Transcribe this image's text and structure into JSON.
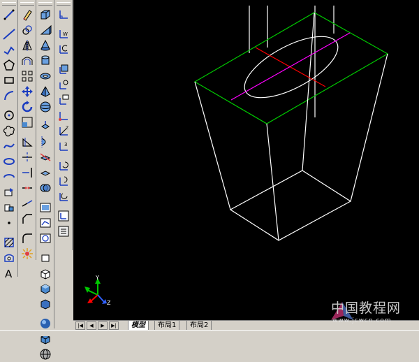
{
  "toolbars": {
    "draw": [
      "line-icon",
      "construction-line-icon",
      "polyline-icon",
      "polygon-icon",
      "rectangle-icon",
      "arc-icon",
      "circle-icon",
      "revision-cloud-icon",
      "spline-icon",
      "ellipse-icon",
      "ellipse-arc-icon",
      "insert-block-icon",
      "make-block-icon",
      "point-icon",
      "hatch-icon",
      "region-icon",
      "multiline-text-icon"
    ],
    "modify": [
      "erase-icon",
      "copy-icon",
      "mirror-icon",
      "offset-icon",
      "array-icon",
      "move-icon",
      "rotate-icon",
      "scale-icon",
      "stretch-icon",
      "trim-icon",
      "extend-icon",
      "break-icon",
      "join-icon",
      "chamfer-icon",
      "fillet-icon",
      "explode-icon"
    ],
    "solids": [
      "box-icon",
      "wedge-icon",
      "cone-icon",
      "cylinder-icon",
      "torus-icon",
      "pyramid-icon",
      "sphere-icon",
      "extrude-icon",
      "revolve-icon",
      "slice-icon",
      "section-icon",
      "interference-icon",
      "setup-view-icon",
      "setup-drawing-icon",
      "setup-profile-icon",
      "shade-2d-icon",
      "shade-3d-icon",
      "shade-gouraud-icon",
      "shade-flat-icon",
      "sphere-shaded-icon",
      "box-shaded-icon",
      "globe-icon"
    ],
    "ucs": [
      "ucs-icon",
      "ucs-world-icon",
      "ucs-previous-icon",
      "ucs-face-icon",
      "ucs-object-icon",
      "ucs-view-icon",
      "ucs-origin-icon",
      "ucs-zaxis-icon",
      "ucs-3point-icon",
      "ucs-x-icon",
      "ucs-y-icon",
      "ucs-z-icon",
      "ucs-apply-icon",
      "ucs-named-icon"
    ]
  },
  "layout_tabs": {
    "model": "模型",
    "layout1": "布局1",
    "layout2": "布局2"
  },
  "nav": {
    "first": "|◀",
    "prev": "◀",
    "next": "▶",
    "last": "▶|"
  },
  "ucs_axes": {
    "y": "Y",
    "z": "Z"
  },
  "watermark": {
    "title": "中国教程网",
    "url": "www.jcwcn.com"
  },
  "colors": {
    "canvas": "#000000",
    "toolbar": "#d4d0c8",
    "top_face": "#00c800",
    "axis_red": "#ff0000",
    "axis_magenta": "#ff00ff",
    "wire": "#ffffff"
  }
}
